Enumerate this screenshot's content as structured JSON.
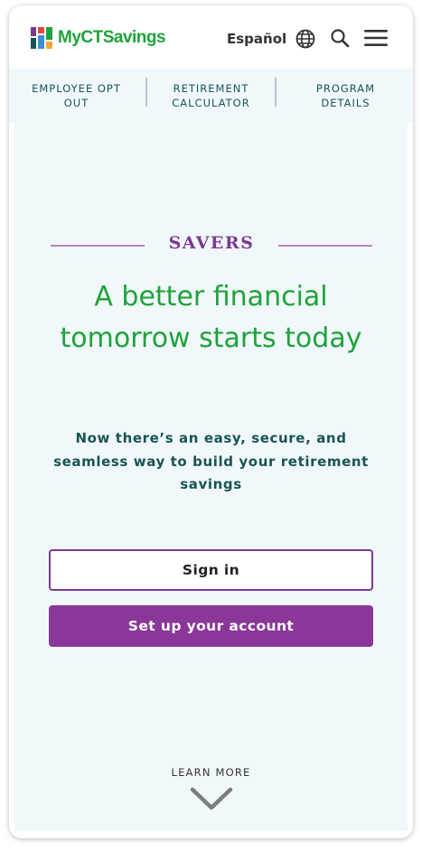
{
  "header": {
    "logo_text": "MyCTSavings",
    "language_label": "Español",
    "icons": [
      "globe-icon",
      "search-icon",
      "hamburger-menu-icon"
    ],
    "logo_colors": [
      "#7b3a8f",
      "#1ea33a",
      "#e04a3a",
      "#f2a93b",
      "#3a8fd6",
      "#185452"
    ]
  },
  "subnav": {
    "items": [
      {
        "label": "EMPLOYEE OPT OUT"
      },
      {
        "label": "RETIREMENT CALCULATOR"
      },
      {
        "label": "PROGRAM DETAILS"
      }
    ]
  },
  "hero": {
    "eyebrow": "SAVERS",
    "headline": "A better financial tomorrow starts today",
    "subhead": "Now there’s an easy, secure, and seamless way to build your retirement savings",
    "signin_label": "Sign in",
    "setup_label": "Set up your account",
    "learn_more_label": "LEARN MORE"
  },
  "colors": {
    "brand_green": "#1ea33a",
    "brand_purple": "#8a3799",
    "eyebrow_purple": "#7b3a8f",
    "teal_text": "#185452",
    "hero_bg": "#f1f8fc"
  }
}
